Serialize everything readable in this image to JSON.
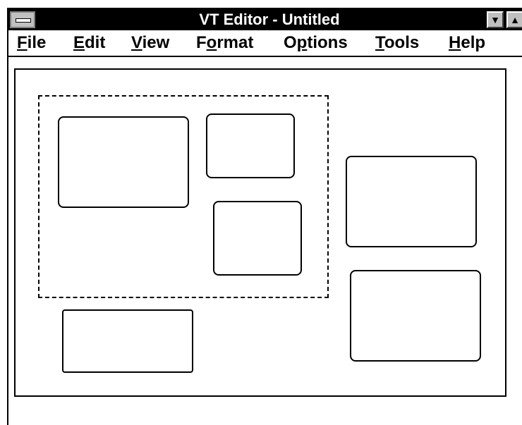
{
  "window": {
    "title": "VT Editor - Untitled",
    "system_menu_icon": "system-menu-icon",
    "minimize_glyph": "▼",
    "maximize_glyph": "▲"
  },
  "menu": [
    {
      "mnemonic": "F",
      "rest": "ile"
    },
    {
      "mnemonic": "E",
      "rest": "dit"
    },
    {
      "mnemonic": "V",
      "rest": "iew"
    },
    {
      "pre": "F",
      "mnemonic": "o",
      "rest": "rmat"
    },
    {
      "pre": "O",
      "mnemonic": "p",
      "rest": "tions"
    },
    {
      "mnemonic": "T",
      "rest": "ools"
    },
    {
      "mnemonic": "H",
      "rest": "elp"
    }
  ],
  "canvas": {
    "objects": [
      "shape",
      "shape",
      "shape",
      "shape",
      "shape",
      "shape",
      "shape"
    ],
    "selected_group": "selection-marquee"
  },
  "colors": {
    "titlebar_bg": "#000000",
    "titlebar_fg": "#ffffff",
    "button_face": "#c0c0c0"
  }
}
